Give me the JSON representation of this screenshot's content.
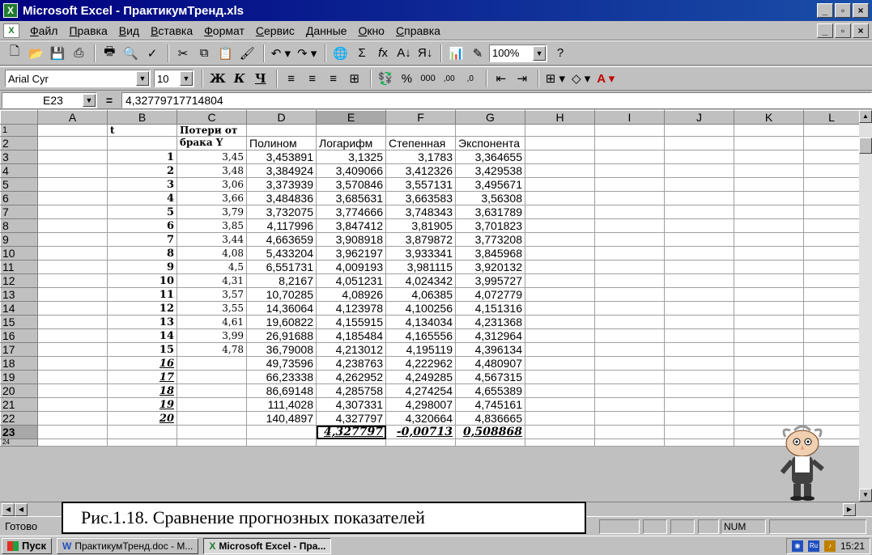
{
  "window": {
    "title": "Microsoft Excel - ПрактикумТренд.xls",
    "buttons": [
      "_",
      "▫",
      "×"
    ]
  },
  "menu": {
    "items": [
      "Файл",
      "Правка",
      "Вид",
      "Вставка",
      "Формат",
      "Сервис",
      "Данные",
      "Окно",
      "Справка"
    ]
  },
  "toolbar_standard": {
    "zoom": "100%"
  },
  "toolbar_format": {
    "font_name": "Arial Cyr",
    "font_size": "10",
    "bold_label": "Ж",
    "italic_label": "К",
    "underline_label": "Ч",
    "percent_label": "%",
    "thousands_label": "000",
    "increase_decimal": ",00",
    "decrease_decimal": ",0"
  },
  "formula_bar": {
    "cell_ref": "E23",
    "eq": "=",
    "value": "4,32779717714804"
  },
  "sheet": {
    "columns": [
      "A",
      "B",
      "C",
      "D",
      "E",
      "F",
      "G",
      "H",
      "I",
      "J",
      "K",
      "L"
    ],
    "header_row1": {
      "num": "1",
      "t": "t",
      "c": "Потери от"
    },
    "header_row2": {
      "num": "2",
      "c": "брака Y",
      "d": "Полином",
      "e": "Логарифм",
      "f": "Степенная",
      "g": "Экспонента"
    },
    "rows": [
      {
        "num": "3",
        "t": "1",
        "y": "3,45",
        "d": "3,453891",
        "e": "3,1325",
        "f": "3,1783",
        "g": "3,364655"
      },
      {
        "num": "4",
        "t": "2",
        "y": "3,48",
        "d": "3,384924",
        "e": "3,409066",
        "f": "3,412326",
        "g": "3,429538"
      },
      {
        "num": "5",
        "t": "3",
        "y": "3,06",
        "d": "3,373939",
        "e": "3,570846",
        "f": "3,557131",
        "g": "3,495671"
      },
      {
        "num": "6",
        "t": "4",
        "y": "3,66",
        "d": "3,484836",
        "e": "3,685631",
        "f": "3,663583",
        "g": "3,56308"
      },
      {
        "num": "7",
        "t": "5",
        "y": "3,79",
        "d": "3,732075",
        "e": "3,774666",
        "f": "3,748343",
        "g": "3,631789"
      },
      {
        "num": "8",
        "t": "6",
        "y": "3,85",
        "d": "4,117996",
        "e": "3,847412",
        "f": "3,81905",
        "g": "3,701823"
      },
      {
        "num": "9",
        "t": "7",
        "y": "3,44",
        "d": "4,663659",
        "e": "3,908918",
        "f": "3,879872",
        "g": "3,773208"
      },
      {
        "num": "10",
        "t": "8",
        "y": "4,08",
        "d": "5,433204",
        "e": "3,962197",
        "f": "3,933341",
        "g": "3,845968"
      },
      {
        "num": "11",
        "t": "9",
        "y": "4,5",
        "d": "6,551731",
        "e": "4,009193",
        "f": "3,981115",
        "g": "3,920132"
      },
      {
        "num": "12",
        "t": "10",
        "y": "4,31",
        "d": "8,2167",
        "e": "4,051231",
        "f": "4,024342",
        "g": "3,995727"
      },
      {
        "num": "13",
        "t": "11",
        "y": "3,57",
        "d": "10,70285",
        "e": "4,08926",
        "f": "4,06385",
        "g": "4,072779"
      },
      {
        "num": "14",
        "t": "12",
        "y": "3,55",
        "d": "14,36064",
        "e": "4,123978",
        "f": "4,100256",
        "g": "4,151316"
      },
      {
        "num": "15",
        "t": "13",
        "y": "4,61",
        "d": "19,60822",
        "e": "4,155915",
        "f": "4,134034",
        "g": "4,231368"
      },
      {
        "num": "16",
        "t": "14",
        "y": "3,99",
        "d": "26,91688",
        "e": "4,185484",
        "f": "4,165556",
        "g": "4,312964"
      },
      {
        "num": "17",
        "t": "15",
        "y": "4,78",
        "d": "36,79008",
        "e": "4,213012",
        "f": "4,195119",
        "g": "4,396134"
      },
      {
        "num": "18",
        "t": "16",
        "y": "",
        "d": "49,73596",
        "e": "4,238763",
        "f": "4,222962",
        "g": "4,480907"
      },
      {
        "num": "19",
        "t": "17",
        "y": "",
        "d": "66,23338",
        "e": "4,262952",
        "f": "4,249285",
        "g": "4,567315"
      },
      {
        "num": "20",
        "t": "18",
        "y": "",
        "d": "86,69148",
        "e": "4,285758",
        "f": "4,274254",
        "g": "4,655389"
      },
      {
        "num": "21",
        "t": "19",
        "y": "",
        "d": "111,4028",
        "e": "4,307331",
        "f": "4,298007",
        "g": "4,745161"
      },
      {
        "num": "22",
        "t": "20",
        "y": "",
        "d": "140,4897",
        "e": "4,327797",
        "f": "4,320664",
        "g": "4,836665"
      }
    ],
    "result_row": {
      "num": "23",
      "e": "4,327797",
      "f": "-0,00713",
      "g": "0,508868"
    },
    "row24": "24"
  },
  "status": {
    "text": "Готово",
    "num": "NUM"
  },
  "taskbar": {
    "start": "Пуск",
    "items": [
      "ПрактикумТренд.doc - M...",
      "Microsoft Excel - Пра..."
    ],
    "tray_lang": "Ru",
    "time": "15:21"
  },
  "caption": "Рис.1.18. Сравнение прогнозных показателей",
  "colors": {
    "title_bar": "#000080",
    "face": "#c0c0c0"
  }
}
